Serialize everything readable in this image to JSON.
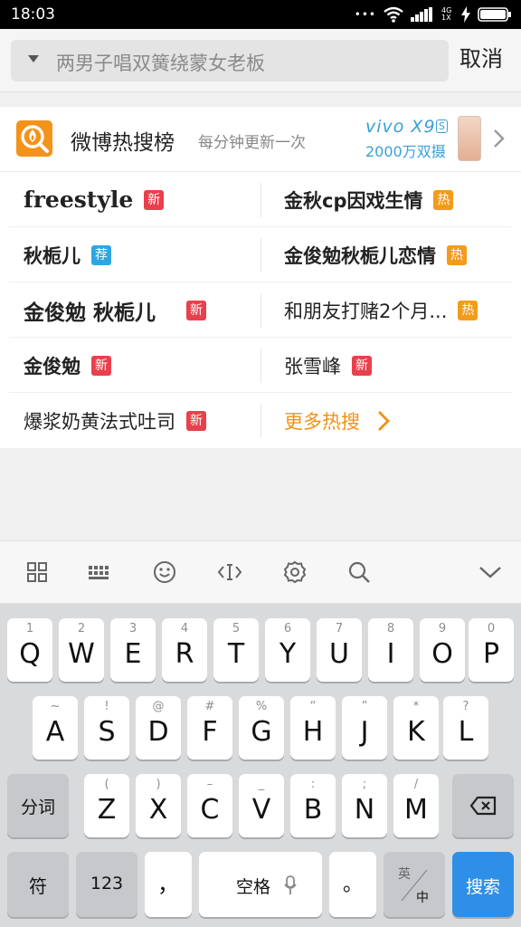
{
  "status_bar": {
    "time": "18:03",
    "dots": "•••",
    "network": "4G 1X",
    "icons": [
      "wifi-icon",
      "signal-icon",
      "charging-icon",
      "battery-icon"
    ]
  },
  "search": {
    "placeholder": "两男子唱双簧绕蒙女老板",
    "cancel_label": "取消"
  },
  "hot_search": {
    "title": "微博热搜榜",
    "subtitle": "每分钟更新一次",
    "ad": {
      "brand": "vivo X9",
      "model_badge": "S",
      "slogan": "2000万双摄"
    },
    "rows": [
      {
        "left": {
          "text": "freestyle",
          "badge": "新"
        },
        "right": {
          "text": "金秋cp因戏生情",
          "badge": "热"
        }
      },
      {
        "left": {
          "text": "秋栀儿",
          "badge": "荐"
        },
        "right": {
          "text": "金俊勉秋栀儿恋情",
          "badge": "热"
        }
      },
      {
        "left": {
          "text": "金俊勉 秋栀儿",
          "badge": "新"
        },
        "right": {
          "text": "和朋友打赌2个月...",
          "badge": "热"
        }
      },
      {
        "left": {
          "text": "金俊勉",
          "badge": "新"
        },
        "right": {
          "text": "张雪峰",
          "badge": "新"
        }
      },
      {
        "left": {
          "text": "爆浆奶黄法式吐司",
          "badge": "新"
        },
        "right": {
          "text": "更多热搜"
        }
      }
    ]
  },
  "colors": {
    "new_badge": "#e8404c",
    "hot_badge": "#f29c1b",
    "rec_badge": "#2ea7e0",
    "accent": "#f29114",
    "search_key": "#2f8fe8",
    "logo": "#f39319"
  },
  "keyboard_toolbar": [
    "grid-icon",
    "keyboard-icon",
    "emoji-icon",
    "cursor-icon",
    "settings-icon",
    "search-icon",
    "collapse-icon"
  ],
  "keyboard": {
    "row1": [
      {
        "hint": "1",
        "label": "Q"
      },
      {
        "hint": "2",
        "label": "W"
      },
      {
        "hint": "3",
        "label": "E"
      },
      {
        "hint": "4",
        "label": "R"
      },
      {
        "hint": "5",
        "label": "T"
      },
      {
        "hint": "6",
        "label": "Y"
      },
      {
        "hint": "7",
        "label": "U"
      },
      {
        "hint": "8",
        "label": "I"
      },
      {
        "hint": "9",
        "label": "O"
      },
      {
        "hint": "0",
        "label": "P"
      }
    ],
    "row2": [
      {
        "hint": "~",
        "label": "A"
      },
      {
        "hint": "!",
        "label": "S"
      },
      {
        "hint": "@",
        "label": "D"
      },
      {
        "hint": "#",
        "label": "F"
      },
      {
        "hint": "%",
        "label": "G"
      },
      {
        "hint": "“",
        "label": "H"
      },
      {
        "hint": "”",
        "label": "J"
      },
      {
        "hint": "*",
        "label": "K"
      },
      {
        "hint": "?",
        "label": "L"
      }
    ],
    "row3": [
      {
        "hint": "(",
        "label": "Z"
      },
      {
        "hint": ")",
        "label": "X"
      },
      {
        "hint": "–",
        "label": "C"
      },
      {
        "hint": "_",
        "label": "V"
      },
      {
        "hint": ":",
        "label": "B"
      },
      {
        "hint": ";",
        "label": "N"
      },
      {
        "hint": "/",
        "label": "M"
      }
    ],
    "fenci": "分词",
    "symbol": "符",
    "num": "123",
    "comma": "，",
    "space": "空格",
    "period": "。",
    "lang_top": "英",
    "lang_bottom": "中",
    "search": "搜索"
  }
}
